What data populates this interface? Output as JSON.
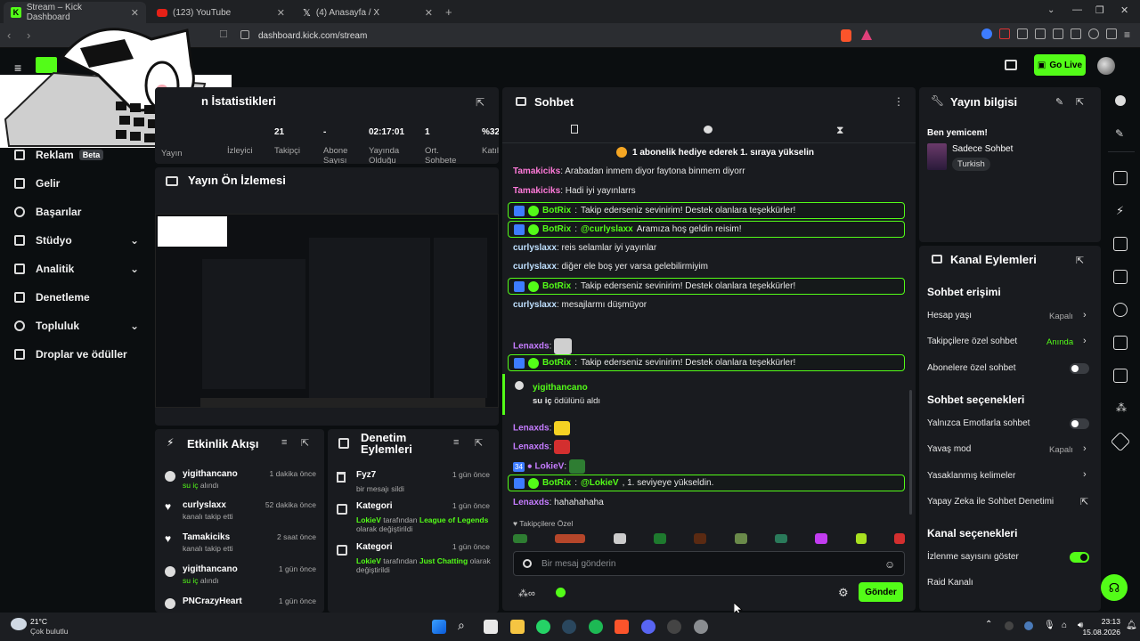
{
  "browser": {
    "tabs": [
      {
        "label": "Stream – Kick Dashboard",
        "active": true
      },
      {
        "label": "(123) YouTube",
        "active": false
      },
      {
        "label": "(4) Anasayfa / X",
        "active": false
      }
    ],
    "url": "dashboard.kick.com/stream"
  },
  "header": {
    "go_live": "Go Live"
  },
  "sidebar": {
    "items": [
      {
        "label": "Reklam",
        "badge": "Beta"
      },
      {
        "label": "Gelir"
      },
      {
        "label": "Başarılar"
      },
      {
        "label": "Stüdyo"
      },
      {
        "label": "Analitik"
      },
      {
        "label": "Denetleme"
      },
      {
        "label": "Topluluk"
      },
      {
        "label": "Droplar ve ödüller"
      }
    ]
  },
  "stats": {
    "title": "Yayın İstatistikleri",
    "title_visible": "n İstatistikleri",
    "columns": [
      {
        "value": "",
        "label": "Yayın"
      },
      {
        "value": "",
        "label": "İzleyici"
      },
      {
        "value": "21",
        "label": "Takipçi"
      },
      {
        "value": "-",
        "label": "Abone Sayısı"
      },
      {
        "value": "02:17:01",
        "label": "Yayında Olduğu"
      },
      {
        "value": "1",
        "label": "Ort. Sohbete"
      },
      {
        "value": "%32",
        "label": "Katıl"
      }
    ]
  },
  "preview": {
    "title": "Yayın Ön İzlemesi"
  },
  "activity": {
    "title": "Etkinlik Akışı",
    "items": [
      {
        "name": "yigithancano",
        "sub": "su iç",
        "sub2": " alındı",
        "time": "1 dakika önce"
      },
      {
        "name": "curlyslaxx",
        "sub": "",
        "sub2": "kanalı takip etti",
        "time": "52 dakika önce"
      },
      {
        "name": "Tamakiciks",
        "sub": "",
        "sub2": "kanalı takip etti",
        "time": "2 saat önce"
      },
      {
        "name": "yigithancano",
        "sub": "su iç",
        "sub2": " alındı",
        "time": "1 gün önce"
      },
      {
        "name": "PNCrazyHeart",
        "sub": "",
        "sub2": "",
        "time": "1 gün önce"
      }
    ]
  },
  "moderation": {
    "title": "Denetim Eylemleri",
    "items": [
      {
        "name": "Fyz7",
        "time": "1 gün önce",
        "line1": "bir mesajı sildi"
      },
      {
        "name": "Kategori",
        "time": "1 gün önce",
        "who": "LokieV",
        "mid": " tarafından ",
        "cat": "League of Legends",
        "line2": "olarak değiştirildi"
      },
      {
        "name": "Kategori",
        "time": "1 gün önce",
        "who": "LokieV",
        "mid": " tarafından ",
        "cat": "Just Chatting",
        "line2": " olarak",
        "line3": "değiştirildi"
      }
    ]
  },
  "chat": {
    "title": "Sohbet",
    "banner": "1 abonelik hediye ederek 1. sıraya yükselin",
    "messages": [
      {
        "user": "Tamakiciks",
        "text": "Arabadan inmem diyor faytona binmem diyorr"
      },
      {
        "user": "Tamakiciks",
        "text": "Hadi iyi yayınlarrs"
      },
      {
        "user": "BotRix",
        "text": "Takip ederseniz sevinirim! Destek olanlara teşekkürler!"
      },
      {
        "user": "BotRix",
        "mention": "@curlyslaxx",
        "text": " Aramıza hoş geldin reisim!"
      },
      {
        "user": "curlyslaxx",
        "text": "reis selamlar iyi yayınlar"
      },
      {
        "user": "curlyslaxx",
        "text": "diğer ele boş yer varsa gelebilirmiyim"
      },
      {
        "user": "BotRix",
        "text": "Takip ederseniz sevinirim! Destek olanlara teşekkürler!"
      },
      {
        "user": "curlyslaxx",
        "text": "mesajlarmı düşmüyor"
      },
      {
        "user": "Lenaxds",
        "text": ""
      },
      {
        "user": "BotRix",
        "text": "Takip ederseniz sevinirim! Destek olanlara teşekkürler!"
      },
      {
        "user": "yigithancano",
        "text": "su iç",
        "text2": " ödülünü aldı"
      },
      {
        "user": "Lenaxds",
        "text": ""
      },
      {
        "user": "Lenaxds",
        "text": ""
      },
      {
        "user": "LokieV",
        "badge": "34",
        "text": ""
      },
      {
        "user": "BotRix",
        "mention": "@LokieV",
        "text": ", 1. seviyeye yükseldin."
      },
      {
        "user": "Lenaxds",
        "text": "hahahahaha"
      }
    ],
    "followers_only": "Takipçilere Özel",
    "input_placeholder": "Bir mesaj gönderin",
    "send": "Gönder"
  },
  "stream_info": {
    "title": "Yayın bilgisi",
    "stream_title": "Ben yemicem!",
    "category": "Sadece Sohbet",
    "tag": "Turkish"
  },
  "channel_actions": {
    "title": "Kanal Eylemleri",
    "chat_access": "Sohbet erişimi",
    "rows_access": [
      {
        "label": "Hesap yaşı",
        "value": "Kapalı"
      },
      {
        "label": "Takipçilere özel sohbet",
        "value": "Anında"
      },
      {
        "label": "Abonelere özel sohbet",
        "value": ""
      }
    ],
    "chat_options": "Sohbet seçenekleri",
    "rows_options": [
      {
        "label": "Yalnızca Emotlarla sohbet",
        "value": ""
      },
      {
        "label": "Yavaş mod",
        "value": "Kapalı"
      },
      {
        "label": "Yasaklanmış kelimeler",
        "value": ""
      },
      {
        "label": "Yapay Zeka ile Sohbet Denetimi",
        "value": ""
      }
    ],
    "channel_options": "Kanal seçenekleri",
    "rows_channel": [
      {
        "label": "İzlenme sayısını göster",
        "value": ""
      },
      {
        "label": "Raid Kanalı",
        "value": ""
      }
    ]
  },
  "taskbar": {
    "weather_temp": "21°C",
    "weather_text": "Çok bulutlu",
    "time": "23:13",
    "date": "15.08.2026"
  },
  "colors": {
    "accent": "#53fc18",
    "panel": "#191b1f",
    "bg": "#0b0e10"
  }
}
